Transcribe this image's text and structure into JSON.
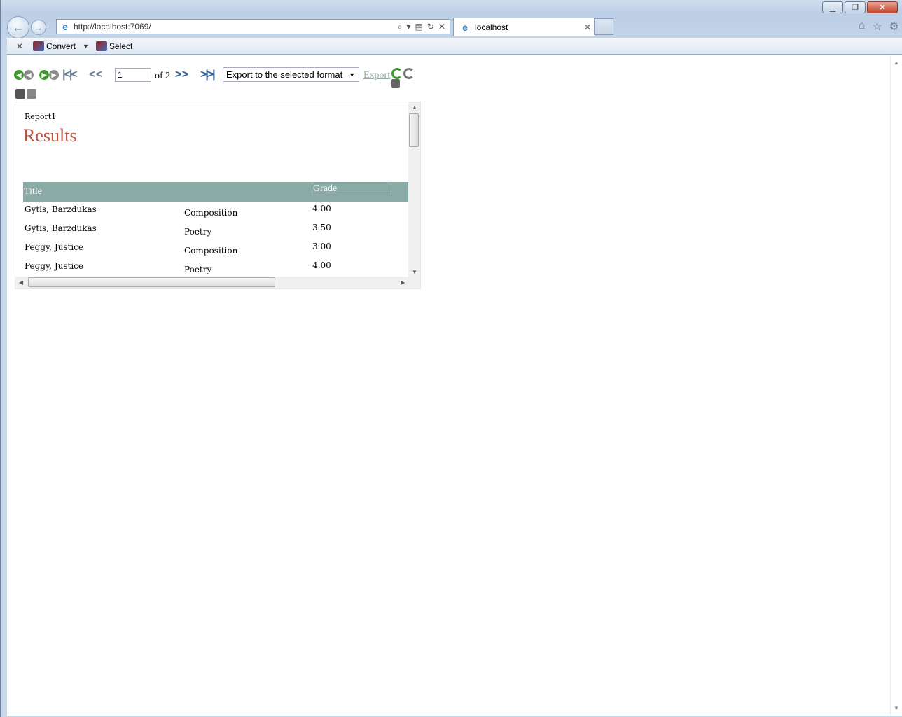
{
  "browser": {
    "url": "http://localhost:7069/",
    "tab_label": "localhost",
    "command_bar": {
      "convert_label": "Convert",
      "select_label": "Select"
    }
  },
  "viewer": {
    "page_number": "1",
    "page_of": "of 2",
    "export_format": "Export to the selected format",
    "export_link": "Export"
  },
  "report": {
    "name": "Report1",
    "title": "Results",
    "headers": {
      "title": "Title",
      "grade": "Grade"
    },
    "rows": [
      {
        "name": "Gytis, Barzdukas",
        "course": "Composition",
        "grade": "4.00"
      },
      {
        "name": "Gytis, Barzdukas",
        "course": "Poetry",
        "grade": "3.50"
      },
      {
        "name": "Peggy, Justice",
        "course": "Composition",
        "grade": "3.00"
      },
      {
        "name": "Peggy, Justice",
        "course": "Poetry",
        "grade": "4.00"
      }
    ]
  },
  "colors": {
    "title_red": "#c0503a",
    "header_teal": "#8aaaa6",
    "nav_green": "#3f9a2f"
  }
}
